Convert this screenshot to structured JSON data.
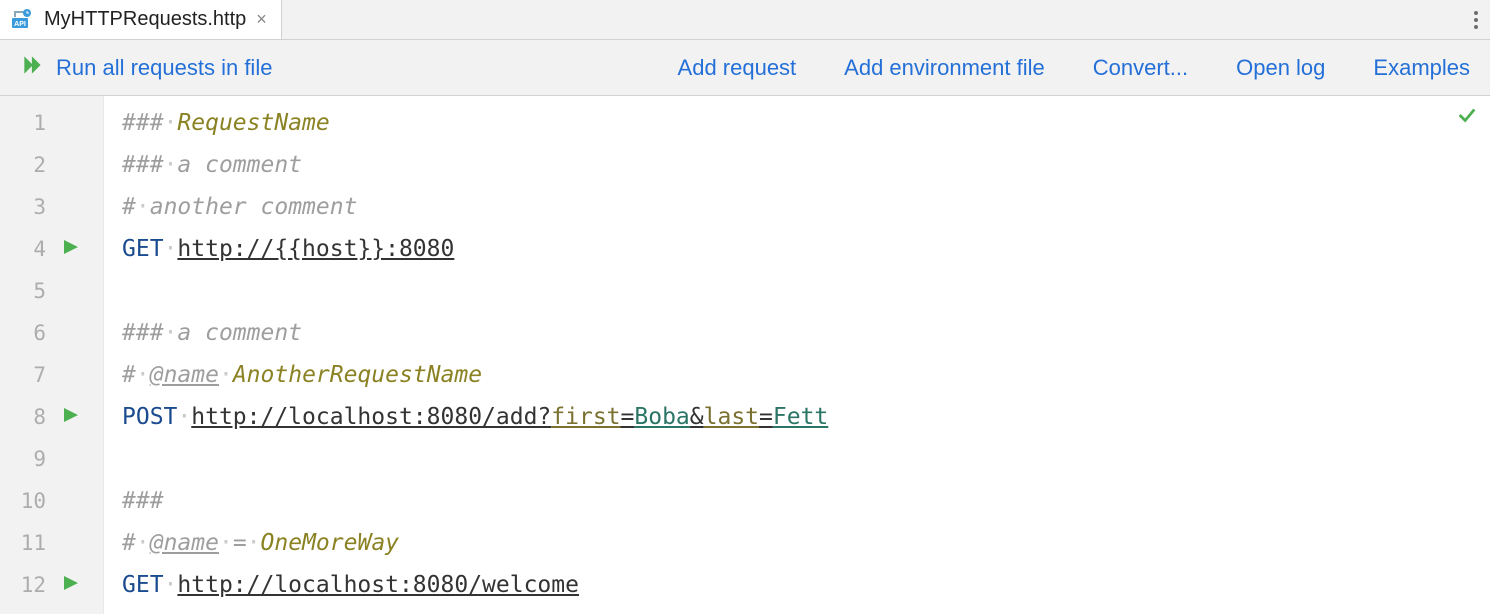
{
  "tab": {
    "filename": "MyHTTPRequests.http"
  },
  "toolbar": {
    "run_all": "Run all requests in file",
    "add_request": "Add request",
    "add_env": "Add environment file",
    "convert": "Convert...",
    "open_log": "Open log",
    "examples": "Examples"
  },
  "gutter": {
    "lines": [
      "1",
      "2",
      "3",
      "4",
      "5",
      "6",
      "7",
      "8",
      "9",
      "10",
      "11",
      "12"
    ],
    "runnable": [
      4,
      8,
      12
    ]
  },
  "code": {
    "l1": {
      "hash": "###",
      "name": "RequestName"
    },
    "l2": {
      "hash": "###",
      "text": "a comment"
    },
    "l3": {
      "hash": "#",
      "text": "another comment"
    },
    "l4": {
      "method": "GET",
      "url": "http://{{host}}:8080"
    },
    "l6": {
      "hash": "###",
      "text": "a comment"
    },
    "l7": {
      "hash": "#",
      "tag": "@name",
      "name": "AnotherRequestName"
    },
    "l8": {
      "method": "POST",
      "url_base": "http://localhost:8080/add?",
      "p1": "first",
      "v1": "Boba",
      "amp": "&",
      "p2": "last",
      "v2": "Fett"
    },
    "l10": {
      "hash": "###"
    },
    "l11": {
      "hash": "#",
      "tag": "@name",
      "eq": "=",
      "name": "OneMoreWay"
    },
    "l12": {
      "method": "GET",
      "url": "http://localhost:8080/welcome"
    }
  }
}
